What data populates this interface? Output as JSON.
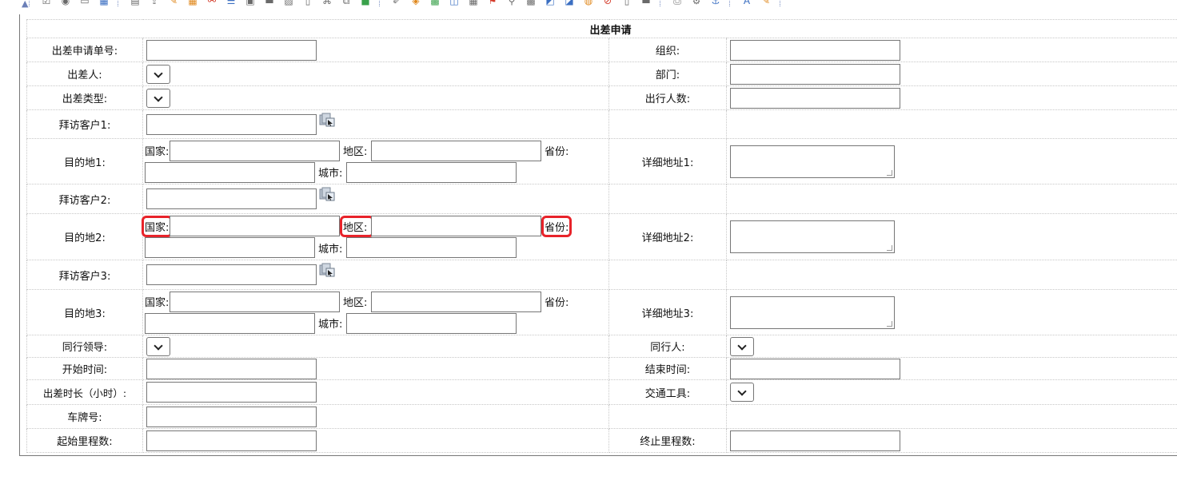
{
  "form": {
    "title": "出差申请",
    "labels": {
      "apply_no": "出差申请单号:",
      "org": "组织:",
      "traveler": "出差人:",
      "dept": "部门:",
      "trip_type": "出差类型:",
      "headcount": "出行人数:",
      "customer1": "拜访客户1:",
      "dest1": "目的地1:",
      "addr1": "详细地址1:",
      "customer2": "拜访客户2:",
      "dest2": "目的地2:",
      "addr2": "详细地址2:",
      "customer3": "拜访客户3:",
      "dest3": "目的地3:",
      "addr3": "详细地址3:",
      "leader": "同行领导:",
      "companion": "同行人:",
      "start_time": "开始时间:",
      "end_time": "结束时间:",
      "duration": "出差时长（小时）:",
      "transport": "交通工具:",
      "plate": "车牌号:",
      "start_mileage": "起始里程数:",
      "end_mileage": "终止里程数:"
    },
    "dest_fields": {
      "country": "国家:",
      "region": "地区:",
      "province": "省份:",
      "city": "城市:"
    }
  }
}
